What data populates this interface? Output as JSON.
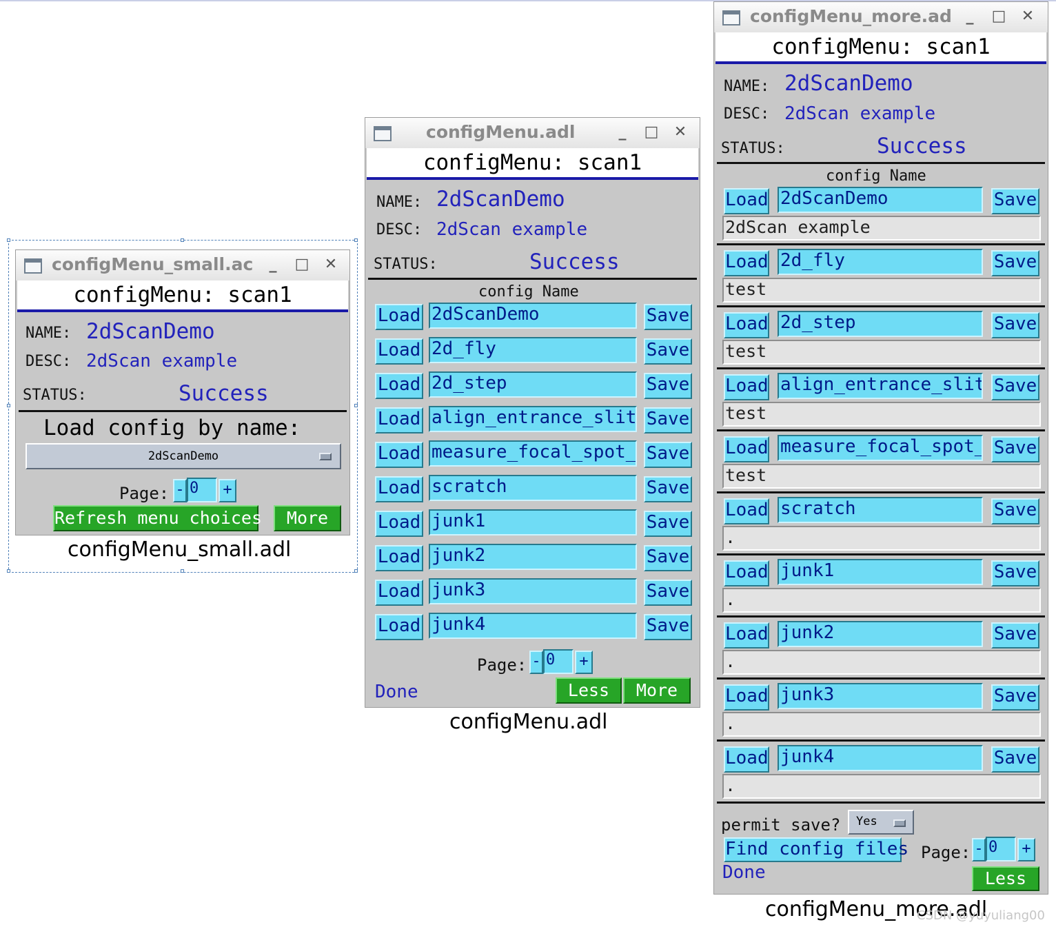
{
  "common": {
    "header": "configMenu: scan1",
    "name_label": "NAME:",
    "name_value": "2dScanDemo",
    "desc_label": "DESC:",
    "desc_value": "2dScan example",
    "status_label": "STATUS:",
    "status_value": "Success",
    "page_label": "Page:",
    "page_value": "0",
    "minus": "-",
    "plus": "+",
    "load_label": "Load",
    "save_label": "Save",
    "done_label": "Done",
    "col_header": "config Name"
  },
  "small": {
    "window_title": "configMenu_small.ac",
    "load_by_name": "Load config by name:",
    "menu_value": "2dScanDemo",
    "refresh_label": "Refresh menu choices",
    "more_label": "More",
    "caption": "configMenu_small.adl"
  },
  "medium": {
    "window_title": "configMenu.adl",
    "configs": [
      "2dScanDemo",
      "2d_fly",
      "2d_step",
      "align_entrance_slit",
      "measure_focal_spot_si",
      "scratch",
      "junk1",
      "junk2",
      "junk3",
      "junk4"
    ],
    "less_label": "Less",
    "more_label": "More",
    "caption": "configMenu.adl"
  },
  "large": {
    "window_title": "configMenu_more.ad",
    "configs": [
      {
        "name": "2dScanDemo",
        "desc": "2dScan example"
      },
      {
        "name": "2d_fly",
        "desc": "test"
      },
      {
        "name": "2d_step",
        "desc": "test"
      },
      {
        "name": "align_entrance_slit",
        "desc": "test"
      },
      {
        "name": "measure_focal_spot_si",
        "desc": "test"
      },
      {
        "name": "scratch",
        "desc": "."
      },
      {
        "name": "junk1",
        "desc": "."
      },
      {
        "name": "junk2",
        "desc": "."
      },
      {
        "name": "junk3",
        "desc": "."
      },
      {
        "name": "junk4",
        "desc": "."
      }
    ],
    "permit_label": "permit save?",
    "permit_value": "Yes",
    "find_label": "Find config files",
    "less_label": "Less",
    "caption": "configMenu_more.adl"
  },
  "watermark": "CSDN @yuyuliang00",
  "colors": {
    "panel_bg": "#c8c8c8",
    "accent_blue": "#1a1aa8",
    "cyan_widget": "#6fdcf5",
    "green_button": "#27a527",
    "value_text": "#2222bb"
  }
}
